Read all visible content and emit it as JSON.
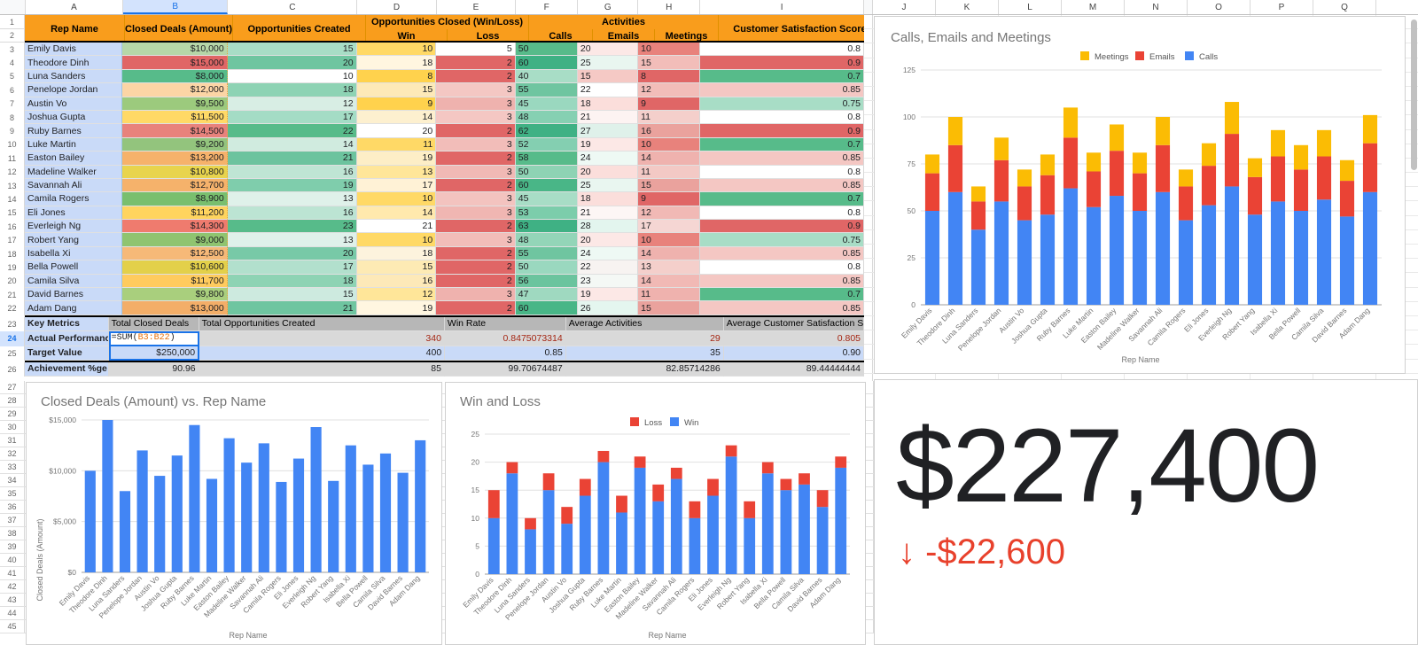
{
  "grid": {
    "columns_left": [
      "A",
      "B",
      "C",
      "D",
      "E",
      "F",
      "G",
      "H",
      "I"
    ],
    "columns_right": [
      "J",
      "K",
      "L",
      "M",
      "N",
      "O",
      "P",
      "Q"
    ],
    "selected_column": "B",
    "selected_row": "24",
    "row_numbers_top": [
      "1",
      "2",
      "3",
      "4",
      "5",
      "6",
      "7",
      "8",
      "9",
      "10",
      "11",
      "12",
      "13",
      "14",
      "15",
      "16",
      "17",
      "18",
      "19",
      "20",
      "21",
      "22",
      "23",
      "24",
      "25",
      "26"
    ],
    "row_numbers_bottom": [
      "27",
      "28",
      "29",
      "30",
      "31",
      "32",
      "33",
      "34",
      "35",
      "36",
      "37",
      "38",
      "39",
      "40",
      "41",
      "42",
      "43",
      "44",
      "45"
    ]
  },
  "table": {
    "headers": {
      "rep_name": "Rep Name",
      "closed_deals": "Closed Deals (Amount)",
      "opportunities_created": "Opportunities Created",
      "opportunities_closed": "Opportunities Closed (Win/Loss)",
      "win": "Win",
      "loss": "Loss",
      "activities": "Activities",
      "calls": "Calls",
      "emails": "Emails",
      "meetings": "Meetings",
      "csat": "Customer Satisfaction Scores"
    },
    "rows": [
      {
        "row": "3",
        "name": "Emily Davis",
        "amount": "$10,000",
        "created": "15",
        "win": "10",
        "loss": "5",
        "calls": "50",
        "emails": "20",
        "meetings": "10",
        "csat": "0.8"
      },
      {
        "row": "4",
        "name": "Theodore Dinh",
        "amount": "$15,000",
        "created": "20",
        "win": "18",
        "loss": "2",
        "calls": "60",
        "emails": "25",
        "meetings": "15",
        "csat": "0.9"
      },
      {
        "row": "5",
        "name": "Luna Sanders",
        "amount": "$8,000",
        "created": "10",
        "win": "8",
        "loss": "2",
        "calls": "40",
        "emails": "15",
        "meetings": "8",
        "csat": "0.7"
      },
      {
        "row": "6",
        "name": "Penelope Jordan",
        "amount": "$12,000",
        "created": "18",
        "win": "15",
        "loss": "3",
        "calls": "55",
        "emails": "22",
        "meetings": "12",
        "csat": "0.85"
      },
      {
        "row": "7",
        "name": "Austin Vo",
        "amount": "$9,500",
        "created": "12",
        "win": "9",
        "loss": "3",
        "calls": "45",
        "emails": "18",
        "meetings": "9",
        "csat": "0.75"
      },
      {
        "row": "8",
        "name": "Joshua Gupta",
        "amount": "$11,500",
        "created": "17",
        "win": "14",
        "loss": "3",
        "calls": "48",
        "emails": "21",
        "meetings": "11",
        "csat": "0.8"
      },
      {
        "row": "9",
        "name": "Ruby Barnes",
        "amount": "$14,500",
        "created": "22",
        "win": "20",
        "loss": "2",
        "calls": "62",
        "emails": "27",
        "meetings": "16",
        "csat": "0.9"
      },
      {
        "row": "10",
        "name": "Luke Martin",
        "amount": "$9,200",
        "created": "14",
        "win": "11",
        "loss": "3",
        "calls": "52",
        "emails": "19",
        "meetings": "10",
        "csat": "0.7"
      },
      {
        "row": "11",
        "name": "Easton Bailey",
        "amount": "$13,200",
        "created": "21",
        "win": "19",
        "loss": "2",
        "calls": "58",
        "emails": "24",
        "meetings": "14",
        "csat": "0.85"
      },
      {
        "row": "12",
        "name": "Madeline Walker",
        "amount": "$10,800",
        "created": "16",
        "win": "13",
        "loss": "3",
        "calls": "50",
        "emails": "20",
        "meetings": "11",
        "csat": "0.8"
      },
      {
        "row": "13",
        "name": "Savannah Ali",
        "amount": "$12,700",
        "created": "19",
        "win": "17",
        "loss": "2",
        "calls": "60",
        "emails": "25",
        "meetings": "15",
        "csat": "0.85"
      },
      {
        "row": "14",
        "name": "Camila Rogers",
        "amount": "$8,900",
        "created": "13",
        "win": "10",
        "loss": "3",
        "calls": "45",
        "emails": "18",
        "meetings": "9",
        "csat": "0.7"
      },
      {
        "row": "15",
        "name": "Eli Jones",
        "amount": "$11,200",
        "created": "16",
        "win": "14",
        "loss": "3",
        "calls": "53",
        "emails": "21",
        "meetings": "12",
        "csat": "0.8"
      },
      {
        "row": "16",
        "name": "Everleigh Ng",
        "amount": "$14,300",
        "created": "23",
        "win": "21",
        "loss": "2",
        "calls": "63",
        "emails": "28",
        "meetings": "17",
        "csat": "0.9"
      },
      {
        "row": "17",
        "name": "Robert Yang",
        "amount": "$9,000",
        "created": "13",
        "win": "10",
        "loss": "3",
        "calls": "48",
        "emails": "20",
        "meetings": "10",
        "csat": "0.75"
      },
      {
        "row": "18",
        "name": "Isabella Xi",
        "amount": "$12,500",
        "created": "20",
        "win": "18",
        "loss": "2",
        "calls": "55",
        "emails": "24",
        "meetings": "14",
        "csat": "0.85"
      },
      {
        "row": "19",
        "name": "Bella Powell",
        "amount": "$10,600",
        "created": "17",
        "win": "15",
        "loss": "2",
        "calls": "50",
        "emails": "22",
        "meetings": "13",
        "csat": "0.8"
      },
      {
        "row": "20",
        "name": "Camila Silva",
        "amount": "$11,700",
        "created": "18",
        "win": "16",
        "loss": "2",
        "calls": "56",
        "emails": "23",
        "meetings": "14",
        "csat": "0.85"
      },
      {
        "row": "21",
        "name": "David Barnes",
        "amount": "$9,800",
        "created": "15",
        "win": "12",
        "loss": "3",
        "calls": "47",
        "emails": "19",
        "meetings": "11",
        "csat": "0.7"
      },
      {
        "row": "22",
        "name": "Adam Dang",
        "amount": "$13,000",
        "created": "21",
        "win": "19",
        "loss": "2",
        "calls": "60",
        "emails": "26",
        "meetings": "15",
        "csat": "0.85"
      }
    ]
  },
  "summary": {
    "key_metrics_label": "Key Metrics",
    "headers": {
      "total_closed": "Total Closed Deals",
      "total_created": "Total Opportunities Created",
      "win_rate": "Win Rate",
      "avg_activities": "Average Activities",
      "avg_csat": "Average Customer Satisfaction Score"
    },
    "actual": {
      "label": "Actual Performances",
      "closed_formula": "=SUM(",
      "closed_range": "B3:B22",
      "closed_formula_end": ")",
      "created": "340",
      "win_rate": "0.8475073314",
      "avg_activities": "29",
      "avg_csat": "0.805"
    },
    "target": {
      "label": "Target Value",
      "closed": "$250,000",
      "created": "400",
      "win_rate": "0.85",
      "avg_activities": "35",
      "avg_csat": "0.90"
    },
    "achievement": {
      "label": "Achievement %ge",
      "closed": "90.96",
      "created": "85",
      "win_rate": "99.70674487",
      "avg_activities": "82.85714286",
      "avg_csat": "89.44444444"
    }
  },
  "kpi": {
    "value": "$227,400",
    "delta": "↓ -$22,600",
    "delta_color": "#e8412c"
  },
  "chart_data": [
    {
      "id": "activities",
      "type": "bar",
      "stacked": true,
      "title": "Calls, Emails and Meetings",
      "xlabel": "Rep Name",
      "ylabel": "",
      "ylim": [
        0,
        125
      ],
      "yticks": [
        0,
        25,
        50,
        75,
        100,
        125
      ],
      "legend_position": "top-right",
      "categories": [
        "Emily Davis",
        "Theodore Dinh",
        "Luna Sanders",
        "Penelope Jordan",
        "Austin Vo",
        "Joshua Gupta",
        "Ruby Barnes",
        "Luke Martin",
        "Easton Bailey",
        "Madeline Walker",
        "Savannah Ali",
        "Camila Rogers",
        "Eli Jones",
        "Everleigh Ng",
        "Robert Yang",
        "Isabella Xi",
        "Bella Powell",
        "Camila Silva",
        "David Barnes",
        "Adam Dang"
      ],
      "series": [
        {
          "name": "Calls",
          "color": "#4285f4",
          "values": [
            50,
            60,
            40,
            55,
            45,
            48,
            62,
            52,
            58,
            50,
            60,
            45,
            53,
            63,
            48,
            55,
            50,
            56,
            47,
            60
          ]
        },
        {
          "name": "Emails",
          "color": "#ea4335",
          "values": [
            20,
            25,
            15,
            22,
            18,
            21,
            27,
            19,
            24,
            20,
            25,
            18,
            21,
            28,
            20,
            24,
            22,
            23,
            19,
            26
          ]
        },
        {
          "name": "Meetings",
          "color": "#fbbc04",
          "values": [
            10,
            15,
            8,
            12,
            9,
            11,
            16,
            10,
            14,
            11,
            15,
            9,
            12,
            17,
            10,
            14,
            13,
            14,
            11,
            15
          ]
        }
      ]
    },
    {
      "id": "closed-deals",
      "type": "bar",
      "stacked": false,
      "title": "Closed Deals (Amount) vs. Rep Name",
      "xlabel": "Rep Name",
      "ylabel": "Closed Deals (Amount)",
      "ylim": [
        0,
        15000
      ],
      "yticks": [
        0,
        5000,
        10000,
        15000
      ],
      "ytick_labels": [
        "$0",
        "$5,000",
        "$10,000",
        "$15,000"
      ],
      "legend_position": "none",
      "categories": [
        "Emily Davis",
        "Theodore Dinh",
        "Luna Sanders",
        "Penelope Jordan",
        "Austin Vo",
        "Joshua Gupta",
        "Ruby Barnes",
        "Luke Martin",
        "Easton Bailey",
        "Madeline Walker",
        "Savannah Ali",
        "Camila Rogers",
        "Eli Jones",
        "Everleigh Ng",
        "Robert Yang",
        "Isabella Xi",
        "Bella Powell",
        "Camila Silva",
        "David Barnes",
        "Adam Dang"
      ],
      "series": [
        {
          "name": "Closed Deals (Amount)",
          "color": "#4285f4",
          "values": [
            10000,
            15000,
            8000,
            12000,
            9500,
            11500,
            14500,
            9200,
            13200,
            10800,
            12700,
            8900,
            11200,
            14300,
            9000,
            12500,
            10600,
            11700,
            9800,
            13000
          ]
        }
      ]
    },
    {
      "id": "win-loss",
      "type": "bar",
      "stacked": true,
      "title": "Win and Loss",
      "xlabel": "Rep Name",
      "ylabel": "",
      "ylim": [
        0,
        25
      ],
      "yticks": [
        0,
        5,
        10,
        15,
        20,
        25
      ],
      "legend_position": "top-center",
      "categories": [
        "Emily Davis",
        "Theodore Dinh",
        "Luna Sanders",
        "Penelope Jordan",
        "Austin Vo",
        "Joshua Gupta",
        "Ruby Barnes",
        "Luke Martin",
        "Easton Bailey",
        "Madeline Walker",
        "Savannah Ali",
        "Camila Rogers",
        "Eli Jones",
        "Everleigh Ng",
        "Robert Yang",
        "Isabella Xi",
        "Bella Powell",
        "Camila Silva",
        "David Barnes",
        "Adam Dang"
      ],
      "series": [
        {
          "name": "Win",
          "color": "#4285f4",
          "values": [
            10,
            18,
            8,
            15,
            9,
            14,
            20,
            11,
            19,
            13,
            17,
            10,
            14,
            21,
            10,
            18,
            15,
            16,
            12,
            19
          ]
        },
        {
          "name": "Loss",
          "color": "#ea4335",
          "values": [
            5,
            2,
            2,
            3,
            3,
            3,
            2,
            3,
            2,
            3,
            2,
            3,
            3,
            2,
            3,
            2,
            2,
            2,
            3,
            2
          ]
        }
      ]
    }
  ]
}
